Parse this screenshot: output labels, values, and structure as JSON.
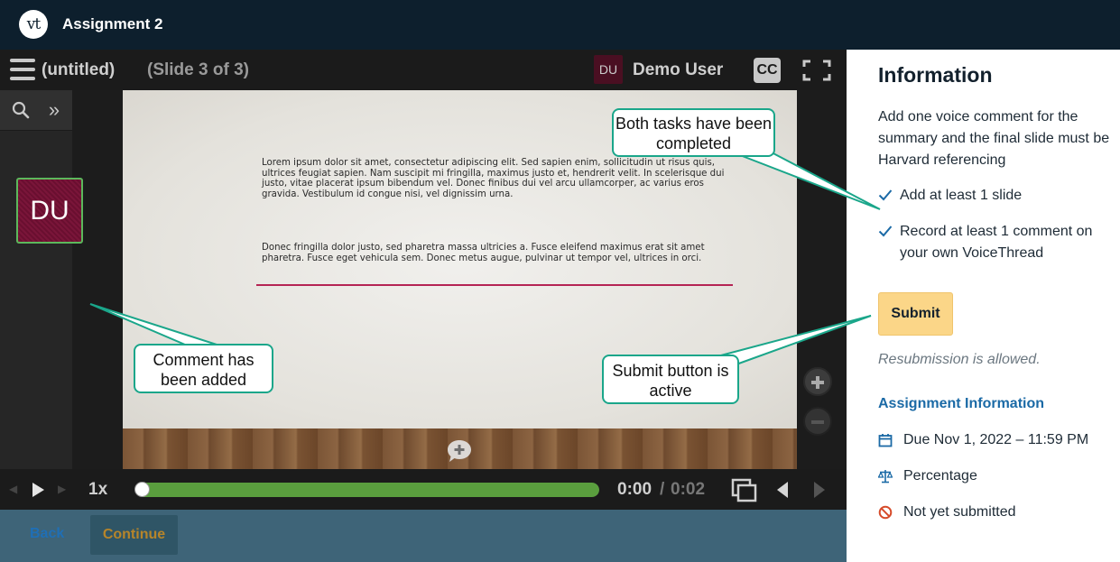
{
  "app": {
    "logo_text": "vt",
    "title": "Assignment 2"
  },
  "player": {
    "menu_icon": "menu-icon",
    "doc_title": "(untitled)",
    "slide_indicator": "(Slide 3 of 3)",
    "user_initials": "DU",
    "user_name": "Demo User",
    "cc_label": "CC",
    "fullscreen_icon": "fullscreen-icon",
    "comment_avatar_initials": "DU",
    "slide": {
      "paragraph1": "Lorem ipsum dolor sit amet, consectetur adipiscing elit. Sed sapien enim, sollicitudin ut risus quis, ultrices feugiat sapien. Nam suscipit mi fringilla, maximus justo et, hendrerit velit. In scelerisque dui justo, vitae placerat ipsum bibendum vel. Donec finibus dui vel arcu ullamcorper, ac varius eros gravida. Vestibulum id congue nisi, vel dignissim urna.",
      "paragraph2": "Donec fringilla dolor justo, sed pharetra massa ultricies a. Fusce eleifend maximus erat sit amet pharetra. Fusce eget vehicula sem. Donec metus augue, pulvinar ut tempor vel, ultrices in orci.",
      "accent_color": "#b52454"
    },
    "playback": {
      "speed": "1x",
      "time_current": "0:00",
      "time_separator": "/",
      "time_total": "0:02",
      "progress_fraction": 0.0,
      "progress_color": "#5a9e3e"
    }
  },
  "footer": {
    "back_label": "Back",
    "continue_label": "Continue"
  },
  "info": {
    "title": "Information",
    "description": "Add one voice comment for the summary and the final slide must be Harvard referencing",
    "requirements": [
      {
        "label": "Add at least 1 slide",
        "done": true
      },
      {
        "label": "Record at least 1 comment on your own VoiceThread",
        "done": true
      }
    ],
    "submit_label": "Submit",
    "resubmission_note": "Resubmission is allowed.",
    "assignment_heading": "Assignment Information",
    "due": "Due Nov 1, 2022 – 11:59 PM",
    "grading": "Percentage",
    "status": "Not yet submitted",
    "accent_color": "#1b6aa6",
    "submit_color": "#fbd688"
  },
  "callouts": {
    "tasks": "Both tasks have been completed",
    "comment": "Comment has been added",
    "submit": "Submit button is active",
    "color": "#1aa68a"
  }
}
